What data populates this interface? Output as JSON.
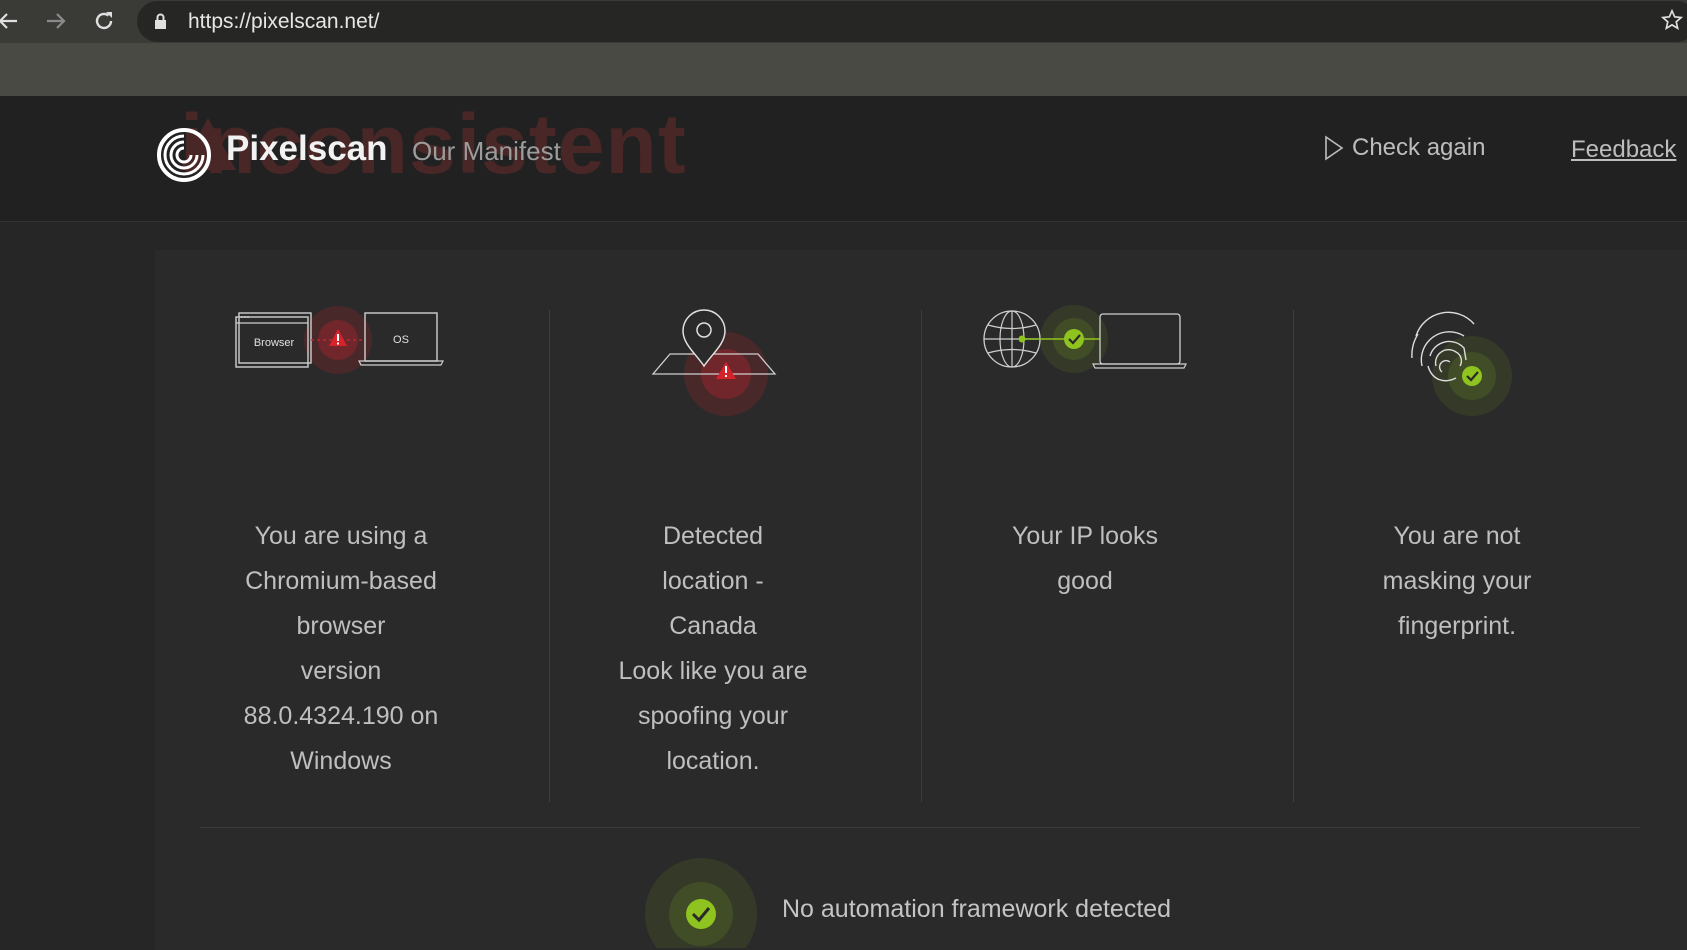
{
  "browser": {
    "url": "https://pixelscan.net/",
    "icons": [
      "back-icon",
      "forward-icon",
      "reload-icon",
      "lock-icon",
      "star-icon"
    ]
  },
  "header": {
    "ghost_text": "inconsistent",
    "brand": "Pixelscan",
    "manifest_link": "Our Manifest",
    "check_again": "Check again",
    "feedback": "Feedback"
  },
  "columns": [
    {
      "icon": "browser-os-warning-icon",
      "browser_label": "Browser",
      "os_label": "OS",
      "lines": [
        "You are using a",
        "Chromium-based",
        "browser",
        "version",
        "88.0.4324.190 on",
        "Windows"
      ],
      "status": "warning"
    },
    {
      "icon": "location-warning-icon",
      "lines": [
        "Detected",
        "location -",
        "Canada",
        "Look like you are",
        "spoofing your",
        "location."
      ],
      "status": "warning"
    },
    {
      "icon": "ip-check-icon",
      "lines": [
        "Your IP looks",
        "good"
      ],
      "status": "ok"
    },
    {
      "icon": "fingerprint-check-icon",
      "lines": [
        "You are not",
        "masking your",
        "fingerprint."
      ],
      "status": "ok"
    }
  ],
  "automation": {
    "text": "No automation framework detected",
    "status": "ok"
  },
  "colors": {
    "warning": "#d6232a",
    "ok": "#8fc31f",
    "background": "#262626"
  }
}
